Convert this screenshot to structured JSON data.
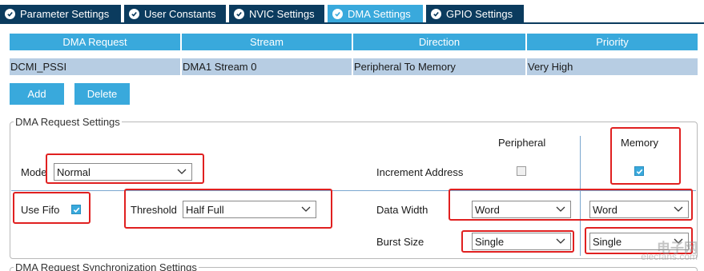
{
  "tabs": [
    {
      "label": "Parameter Settings",
      "active": false
    },
    {
      "label": "User Constants",
      "active": false
    },
    {
      "label": "NVIC Settings",
      "active": false
    },
    {
      "label": "DMA Settings",
      "active": true
    },
    {
      "label": "GPIO Settings",
      "active": false
    }
  ],
  "table": {
    "columns": [
      "DMA Request",
      "Stream",
      "Direction",
      "Priority"
    ],
    "rows": [
      [
        "DCMI_PSSI",
        "DMA1 Stream 0",
        "Peripheral To Memory",
        "Very High"
      ]
    ]
  },
  "buttons": {
    "add": "Add",
    "delete": "Delete"
  },
  "request_settings": {
    "title": "DMA Request Settings",
    "peripheral_header": "Peripheral",
    "memory_header": "Memory",
    "mode_label": "Mode",
    "mode_value": "Normal",
    "increment_address_label": "Increment Address",
    "peripheral_increment": false,
    "memory_increment": true,
    "use_fifo_label": "Use Fifo",
    "use_fifo": true,
    "threshold_label": "Threshold",
    "threshold_value": "Half Full",
    "data_width_label": "Data Width",
    "peripheral_data_width": "Word",
    "memory_data_width": "Word",
    "burst_size_label": "Burst Size",
    "peripheral_burst_size": "Single",
    "memory_burst_size": "Single"
  },
  "sync_settings": {
    "title": "DMA Request Synchronization Settings"
  },
  "watermark": {
    "line1": "电子网",
    "line2": "elecfans.com"
  },
  "colors": {
    "tab_dark": "#0b3b5e",
    "tab_active": "#39a9dc",
    "accent": "#39a9dc",
    "row": "#b7cde3",
    "highlight": "#e02020"
  }
}
